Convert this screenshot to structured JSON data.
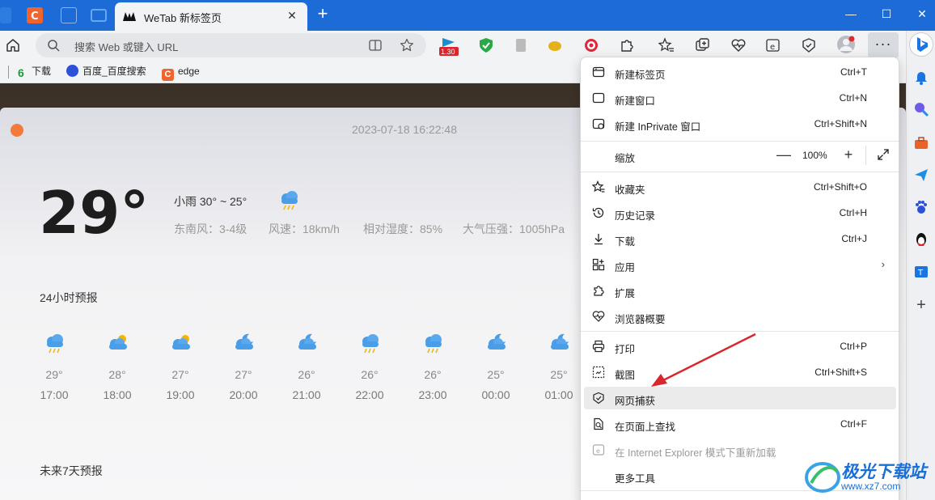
{
  "tab": {
    "title": "WeTab 新标签页"
  },
  "window": {
    "minimize": "—",
    "maximize": "☐",
    "close": "✕"
  },
  "toolbar": {
    "address_placeholder": "搜索 Web 或键入 URL",
    "badge": "1.30"
  },
  "bookmarks": [
    {
      "label": "下载"
    },
    {
      "label": "百度_百度搜索"
    },
    {
      "label": "edge"
    }
  ],
  "weather": {
    "datetime": "2023-07-18 16:22:48",
    "temperature": "29°",
    "condition": "小雨   30° ~ 25°",
    "wind": "东南风：3-4级",
    "wind_speed": "风速：18km/h",
    "humidity": "相对湿度：85%",
    "pressure": "大气压强：1005hPa",
    "hourly_title": "24小时预报",
    "weekly_title": "未来7天预报",
    "hourly": [
      {
        "temp": "29°",
        "time": "17:00",
        "icon": "rain-cloud-icon"
      },
      {
        "temp": "28°",
        "time": "18:00",
        "icon": "sun-cloud-icon"
      },
      {
        "temp": "27°",
        "time": "19:00",
        "icon": "sun-cloud-icon"
      },
      {
        "temp": "27°",
        "time": "20:00",
        "icon": "moon-cloud-icon"
      },
      {
        "temp": "26°",
        "time": "21:00",
        "icon": "moon-cloud-icon"
      },
      {
        "temp": "26°",
        "time": "22:00",
        "icon": "rain-cloud-icon"
      },
      {
        "temp": "26°",
        "time": "23:00",
        "icon": "rain-cloud-icon"
      },
      {
        "temp": "25°",
        "time": "00:00",
        "icon": "moon-cloud-icon"
      },
      {
        "temp": "25°",
        "time": "01:00",
        "icon": "moon-cloud-icon"
      }
    ]
  },
  "menu": {
    "new_tab": {
      "label": "新建标签页",
      "shortcut": "Ctrl+T"
    },
    "new_window": {
      "label": "新建窗口",
      "shortcut": "Ctrl+N"
    },
    "new_inprivate": {
      "label": "新建 InPrivate 窗口",
      "shortcut": "Ctrl+Shift+N"
    },
    "zoom": {
      "label": "缩放",
      "minus": "—",
      "value": "100%",
      "plus": "+"
    },
    "favorites": {
      "label": "收藏夹",
      "shortcut": "Ctrl+Shift+O"
    },
    "history": {
      "label": "历史记录",
      "shortcut": "Ctrl+H"
    },
    "downloads": {
      "label": "下载",
      "shortcut": "Ctrl+J"
    },
    "apps": {
      "label": "应用",
      "arrow": "›"
    },
    "extensions": {
      "label": "扩展"
    },
    "browser_essentials": {
      "label": "浏览器概要"
    },
    "print": {
      "label": "打印",
      "shortcut": "Ctrl+P"
    },
    "screenshot": {
      "label": "截图",
      "shortcut": "Ctrl+Shift+S"
    },
    "web_capture": {
      "label": "网页捕获"
    },
    "find_on_page": {
      "label": "在页面上查找",
      "shortcut": "Ctrl+F"
    },
    "ie_mode": {
      "label": "在 Internet Explorer 模式下重新加载"
    },
    "more_tools": {
      "label": "更多工具",
      "arrow": "›"
    }
  },
  "watermark": {
    "text": "极光下载站",
    "url": "www.xz7.com"
  },
  "colors": {
    "tabstrip": "#1c6bd6",
    "accent": "#1a73e8",
    "orange_dot": "#f47a3a",
    "arrow": "#d9272e"
  }
}
